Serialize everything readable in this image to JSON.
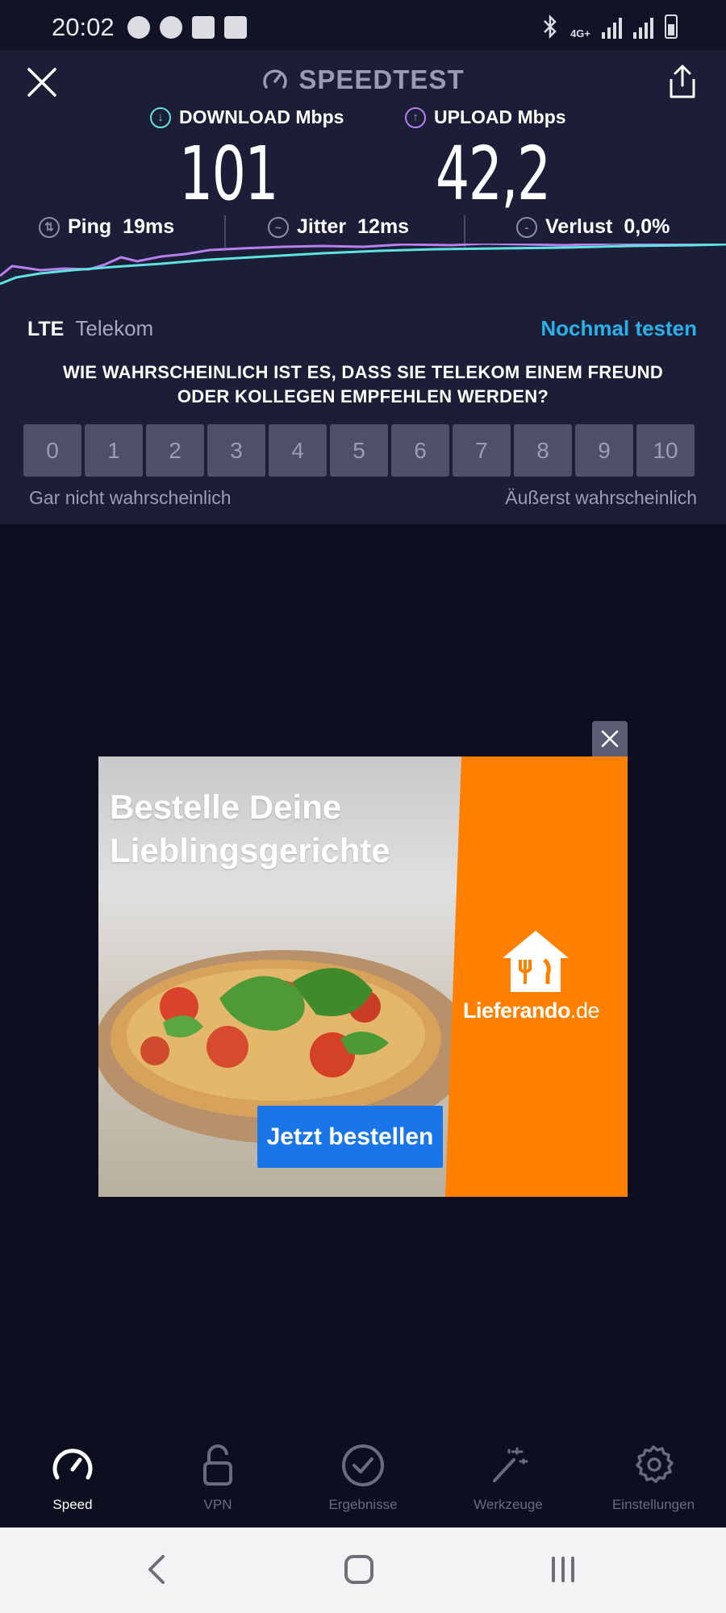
{
  "status_bar": {
    "time": "20:02",
    "network": "4G+",
    "icons": [
      "spotify-icon",
      "whatsapp-icon",
      "mail-icon",
      "gallery-icon",
      "bluetooth-icon",
      "signal-icon",
      "battery-icon"
    ]
  },
  "header": {
    "title": "SPEEDTEST",
    "close_icon": "close-icon",
    "share_icon": "share-icon"
  },
  "results": {
    "download_label": "DOWNLOAD Mbps",
    "download_value": "101",
    "upload_label": "UPLOAD Mbps",
    "upload_value": "42,2",
    "ping_label": "Ping",
    "ping_value": "19ms",
    "jitter_label": "Jitter",
    "jitter_value": "12ms",
    "loss_label": "Verlust",
    "loss_value": "0,0%"
  },
  "connection": {
    "type": "LTE",
    "carrier": "Telekom",
    "retest_label": "Nochmal testen"
  },
  "survey": {
    "question_line1": "WIE WAHRSCHEINLICH IST ES, DASS SIE TELEKOM EINEM FREUND",
    "question_line2": "ODER KOLLEGEN EMPFEHLEN WERDEN?",
    "options": [
      "0",
      "1",
      "2",
      "3",
      "4",
      "5",
      "6",
      "7",
      "8",
      "9",
      "10"
    ],
    "low_label": "Gar nicht wahrscheinlich",
    "high_label": "Äußerst wahrscheinlich"
  },
  "ad": {
    "headline_line1": "Bestelle Deine",
    "headline_line2": "Lieblingsgerichte",
    "brand_name": "Lieferando",
    "brand_tld": ".de",
    "cta_label": "Jetzt bestellen"
  },
  "bottom_nav": {
    "items": [
      {
        "label": "Speed",
        "icon": "speedometer-icon",
        "active": true
      },
      {
        "label": "VPN",
        "icon": "lock-icon",
        "active": false
      },
      {
        "label": "Ergebnisse",
        "icon": "check-circle-icon",
        "active": false
      },
      {
        "label": "Werkzeuge",
        "icon": "magic-wand-icon",
        "active": false
      },
      {
        "label": "Einstellungen",
        "icon": "gear-icon",
        "active": false
      }
    ]
  },
  "colors": {
    "panel_bg": "#1c1d36",
    "page_bg": "#0d0e1f",
    "download_accent": "#5fe3e0",
    "upload_accent": "#b77ff0",
    "link_blue": "#29b2ea",
    "ad_orange": "#ff8000",
    "cta_blue": "#1a75e8"
  }
}
